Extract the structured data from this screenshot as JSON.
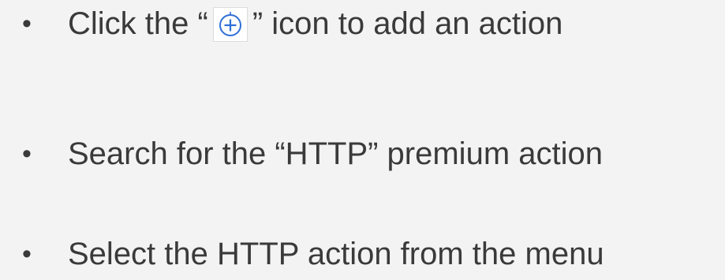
{
  "slide": {
    "bullet_char": "•",
    "items": [
      {
        "text_before": "Click the “",
        "text_after": "” icon to add an action",
        "icon": "add-circle-icon"
      },
      {
        "text": "Search for the “HTTP” premium action"
      },
      {
        "text": "Select the HTTP action from the menu"
      }
    ]
  },
  "colors": {
    "background": "#f3f3f3",
    "text": "#3a3a3a",
    "icon_accent": "#2f6fd6"
  }
}
